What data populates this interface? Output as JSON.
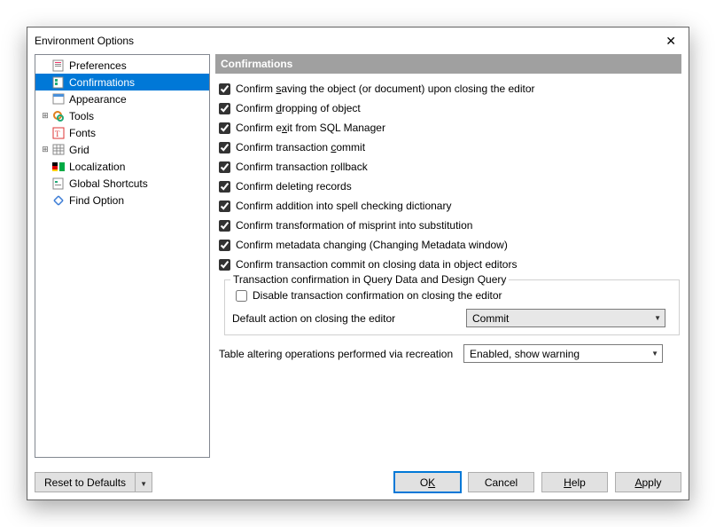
{
  "titlebar": {
    "title": "Environment Options"
  },
  "tree": {
    "preferences": "Preferences",
    "confirmations": "Confirmations",
    "appearance": "Appearance",
    "tools": "Tools",
    "fonts": "Fonts",
    "grid": "Grid",
    "localization": "Localization",
    "global_shortcuts": "Global Shortcuts",
    "find_option": "Find Option"
  },
  "section": {
    "title": "Confirmations"
  },
  "checks": {
    "c0": {
      "pre": "Confirm ",
      "mn": "s",
      "post": "aving the object (or document) upon closing the editor",
      "checked": true
    },
    "c1": {
      "pre": "Confirm ",
      "mn": "d",
      "post": "ropping of object",
      "checked": true
    },
    "c2": {
      "pre": "Confirm e",
      "mn": "x",
      "post": "it from SQL Manager",
      "checked": true
    },
    "c3": {
      "pre": "Confirm transaction ",
      "mn": "c",
      "post": "ommit",
      "checked": true
    },
    "c4": {
      "pre": "Confirm transaction ",
      "mn": "r",
      "post": "ollback",
      "checked": true
    },
    "c5": {
      "pre": "Confirm deleting records",
      "mn": "",
      "post": "",
      "checked": true
    },
    "c6": {
      "pre": "Confirm addition into spell checking dictionary",
      "mn": "",
      "post": "",
      "checked": true
    },
    "c7": {
      "pre": "Confirm transformation of misprint into substitution",
      "mn": "",
      "post": "",
      "checked": true
    },
    "c8": {
      "pre": "Confirm metadata changing (Changing Metadata window)",
      "mn": "",
      "post": "",
      "checked": true
    },
    "c9": {
      "pre": "Confirm transaction commit on closing data in object editors",
      "mn": "",
      "post": "",
      "checked": true
    }
  },
  "group": {
    "title": "Transaction confirmation in Query Data and Design Query",
    "disable": {
      "label": "Disable transaction confirmation on closing the editor",
      "checked": false
    },
    "default_label": "Default action on closing the editor",
    "default_value": "Commit"
  },
  "table_alter": {
    "label": "Table altering operations performed via recreation",
    "value": "Enabled, show warning"
  },
  "footer": {
    "reset": "Reset to Defaults",
    "ok_pre": "O",
    "ok_mn": "K",
    "cancel": "Cancel",
    "help_mn": "H",
    "help_post": "elp",
    "apply_mn": "A",
    "apply_post": "pply"
  }
}
